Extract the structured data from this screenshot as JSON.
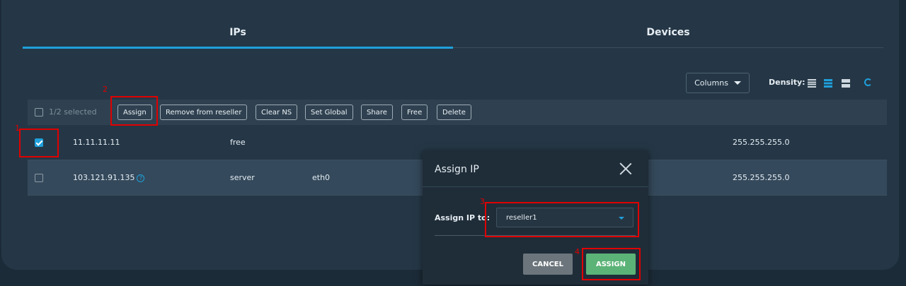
{
  "tabs": [
    {
      "label": "IPs",
      "active": true
    },
    {
      "label": "Devices",
      "active": false
    }
  ],
  "controls": {
    "columns_label": "Columns",
    "density_label": "Density:",
    "density_options": [
      "compact-icon",
      "normal-icon",
      "wide-icon"
    ],
    "active_density": "normal"
  },
  "toolbar": {
    "selected_text": "1/2 selected",
    "buttons": [
      "Assign",
      "Remove from reseller",
      "Clear NS",
      "Set Global",
      "Share",
      "Free",
      "Delete"
    ]
  },
  "rows": [
    {
      "checked": true,
      "ip": "11.11.11.11",
      "status": "free",
      "device": "",
      "netmask": "255.255.255.0",
      "has_help": false
    },
    {
      "checked": false,
      "ip": "103.121.91.135",
      "status": "server",
      "device": "eth0",
      "netmask": "255.255.255.0",
      "has_help": true
    }
  ],
  "modal": {
    "title": "Assign IP",
    "field_label": "Assign IP to:",
    "selected_value": "reseller1",
    "cancel_label": "CANCEL",
    "assign_label": "ASSIGN"
  },
  "annotations": [
    "1",
    "2",
    "3",
    "4"
  ],
  "colors": {
    "accent": "#1fa0dc",
    "highlight": "#e00000",
    "assign_button": "#5cb377",
    "cancel_button": "#6c757c"
  }
}
